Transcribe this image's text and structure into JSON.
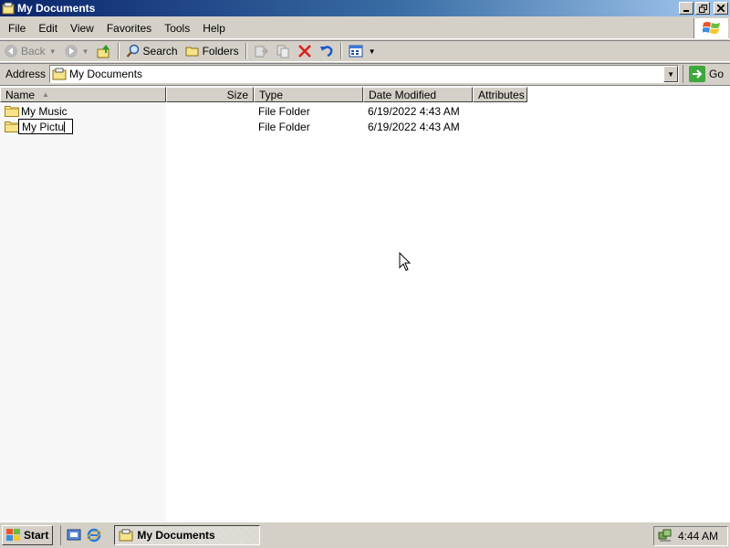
{
  "window": {
    "title": "My Documents"
  },
  "menu": {
    "items": [
      "File",
      "Edit",
      "View",
      "Favorites",
      "Tools",
      "Help"
    ]
  },
  "toolbar": {
    "back": "Back",
    "search": "Search",
    "folders": "Folders",
    "icons": [
      "back-icon",
      "forward-icon",
      "up-folder-icon",
      "search-icon",
      "folders-icon",
      "move-to-icon",
      "copy-to-icon",
      "delete-icon",
      "undo-icon",
      "views-icon"
    ]
  },
  "address": {
    "label": "Address",
    "value": "My Documents",
    "go": "Go"
  },
  "columns": [
    {
      "label": "Name"
    },
    {
      "label": "Size"
    },
    {
      "label": "Type"
    },
    {
      "label": "Date Modified"
    },
    {
      "label": "Attributes"
    }
  ],
  "rows": [
    {
      "name": "My Music",
      "size": "",
      "type": "File Folder",
      "modified": "6/19/2022 4:43 AM",
      "attributes": ""
    },
    {
      "name": "My Pictu",
      "size": "",
      "type": "File Folder",
      "modified": "6/19/2022 4:43 AM",
      "attributes": "",
      "renaming": true
    }
  ],
  "taskbar": {
    "start": "Start",
    "task": "My Documents",
    "clock": "4:44 AM"
  },
  "colors": {
    "titlebar_start": "#0a246a",
    "titlebar_end": "#a6caf0",
    "chrome": "#d4d0c8"
  }
}
